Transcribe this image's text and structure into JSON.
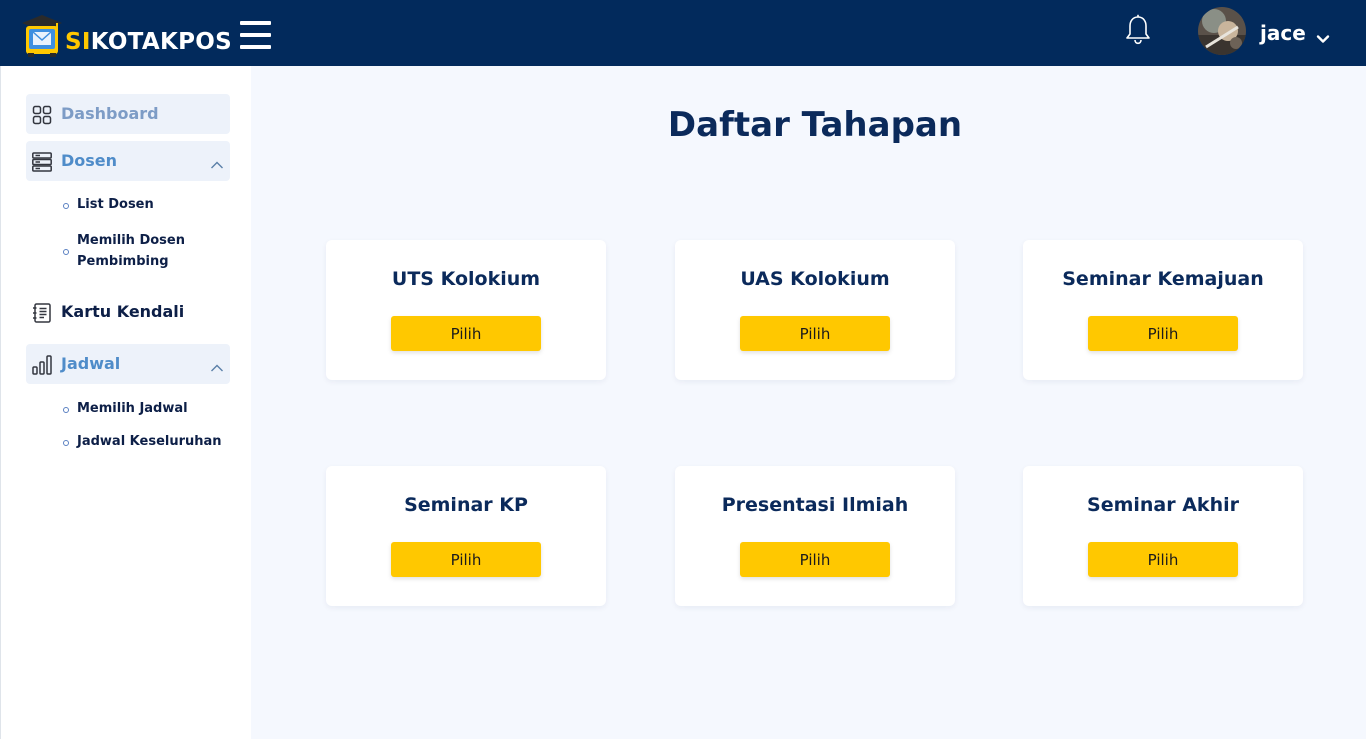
{
  "header": {
    "brand_prefix": "SI",
    "brand_rest": "KOTAKPOS",
    "username": "jace",
    "logo_icon": "graduation-mailbox-logo",
    "menu_icon": "hamburger-icon",
    "notification_icon": "bell-icon"
  },
  "sidebar": {
    "items": [
      {
        "label": "Dashboard",
        "icon": "grid-icon"
      },
      {
        "label": "Dosen",
        "icon": "server-icon",
        "expanded": true,
        "children": [
          {
            "label": "List Dosen"
          },
          {
            "label": "Memilih Dosen",
            "label2": "Pembimbing"
          }
        ]
      },
      {
        "label": "Kartu Kendali",
        "icon": "document-list-icon"
      },
      {
        "label": "Jadwal",
        "icon": "bar-chart-icon",
        "expanded": true,
        "children": [
          {
            "label": "Memilih Jadwal"
          },
          {
            "label": "Jadwal Keseluruhan"
          }
        ]
      }
    ]
  },
  "main": {
    "title": "Daftar Tahapan",
    "cards": [
      {
        "title": "UTS Kolokium",
        "button": "Pilih"
      },
      {
        "title": "UAS Kolokium",
        "button": "Pilih"
      },
      {
        "title": "Seminar Kemajuan",
        "button": "Pilih"
      },
      {
        "title": "Seminar KP",
        "button": "Pilih"
      },
      {
        "title": "Presentasi Ilmiah",
        "button": "Pilih"
      },
      {
        "title": "Seminar Akhir",
        "button": "Pilih"
      }
    ]
  },
  "colors": {
    "header_bg": "#022a5c",
    "accent_yellow": "#ffc800",
    "sidebar_active_text": "#4f8cc9",
    "page_bg": "#f5f8fe"
  }
}
